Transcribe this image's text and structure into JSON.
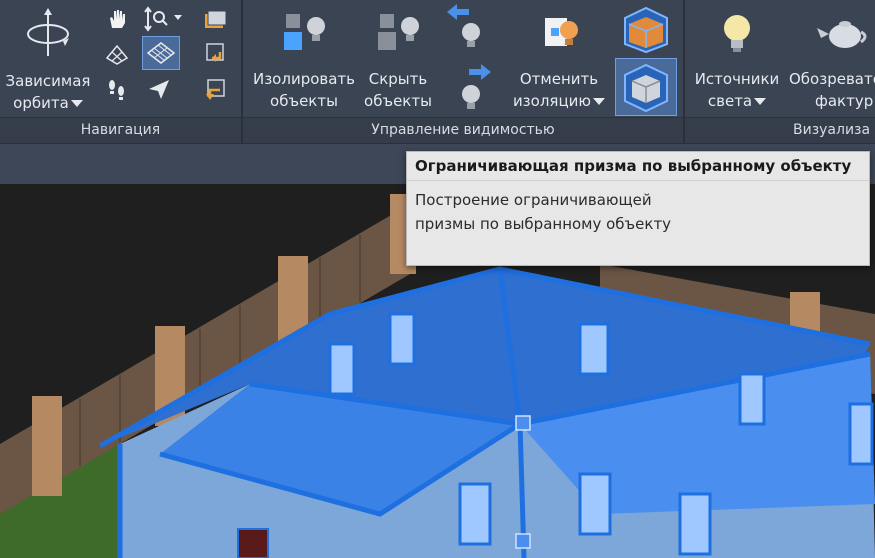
{
  "ribbon": {
    "navigation": {
      "title": "Навигация",
      "orbit_line1": "Зависимая",
      "orbit_line2": "орбита"
    },
    "visibility": {
      "title": "Управление видимостью",
      "isolate_line1": "Изолировать",
      "isolate_line2": "объекты",
      "hide_line1": "Скрыть",
      "hide_line2": "объекты",
      "cancel_line1": "Отменить",
      "cancel_line2": "изоляцию"
    },
    "visualization": {
      "title": "Визуализа",
      "lights_line1": "Источники",
      "lights_line2": "света",
      "materials_line1": "Обозревате",
      "materials_line2": "фактур"
    }
  },
  "tooltip": {
    "title": "Ограничивающая призма по выбранному объекту",
    "description": "Построение ограничивающей призмы по выбранному объекту"
  },
  "colors": {
    "ribbon_bg": "#3b4453",
    "selection_blue": "#1e6fe0",
    "tooltip_bg": "#e7e7e7"
  }
}
